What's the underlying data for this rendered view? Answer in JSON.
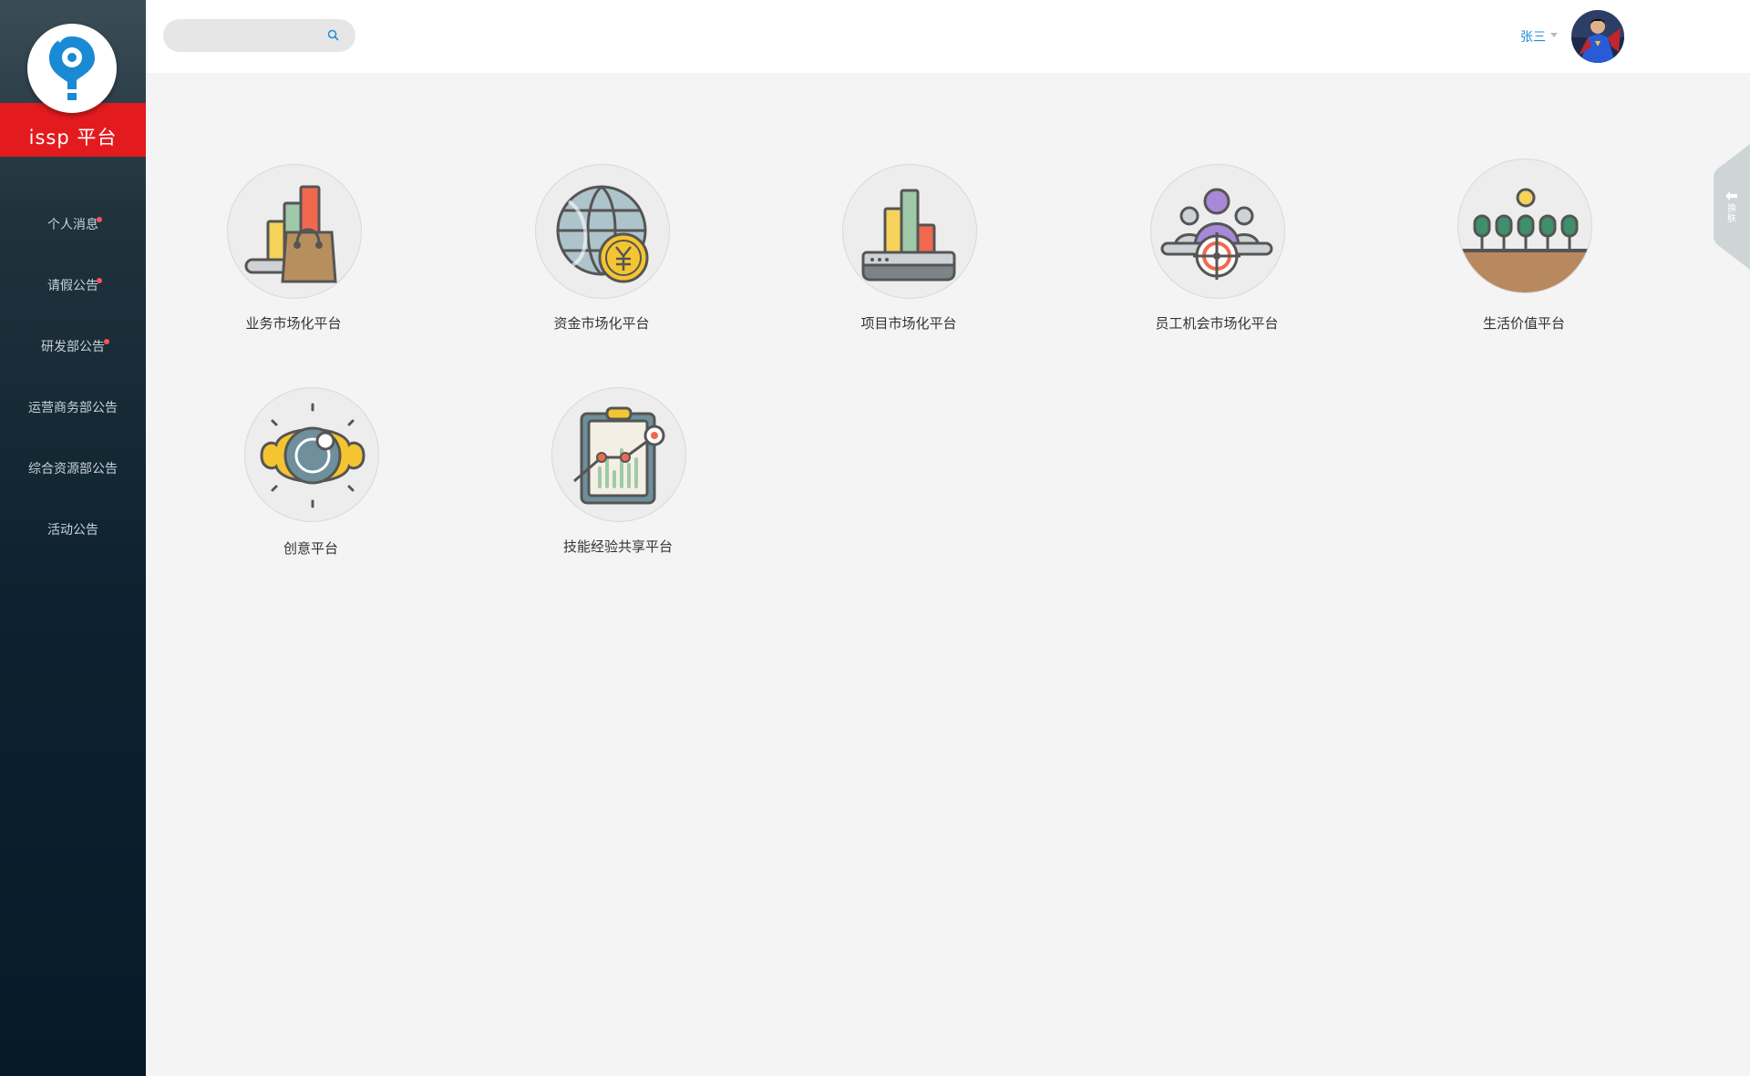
{
  "brand": {
    "name": "issp 平台"
  },
  "sidebar": {
    "items": [
      {
        "label": "个人消息",
        "badge": true
      },
      {
        "label": "请假公告",
        "badge": true
      },
      {
        "label": "研发部公告",
        "badge": true
      },
      {
        "label": "运营商务部公告",
        "badge": false
      },
      {
        "label": "综合资源部公告",
        "badge": false
      },
      {
        "label": "活动公告",
        "badge": false
      }
    ]
  },
  "header": {
    "search": {
      "value": "",
      "placeholder": ""
    },
    "user": {
      "name": "张三"
    }
  },
  "skin_tab": {
    "label": "换肤"
  },
  "platforms": [
    {
      "label": "业务市场化平台",
      "icon": "shopping-bag-chart-icon"
    },
    {
      "label": "资金市场化平台",
      "icon": "globe-yen-icon"
    },
    {
      "label": "项目市场化平台",
      "icon": "bar-chart-tray-icon"
    },
    {
      "label": "员工机会市场化平台",
      "icon": "people-target-icon"
    },
    {
      "label": "生活价值平台",
      "icon": "trees-bowl-icon"
    },
    {
      "label": "创意平台",
      "icon": "lens-ring-icon"
    },
    {
      "label": "技能经验共享平台",
      "icon": "clipboard-chart-icon"
    }
  ],
  "colors": {
    "sidebar_top": "#3a4d57",
    "sidebar_bottom": "#061a28",
    "brand_red": "#e31b1f",
    "accent_blue": "#1e8fd8",
    "badge_red": "#f2545b"
  }
}
